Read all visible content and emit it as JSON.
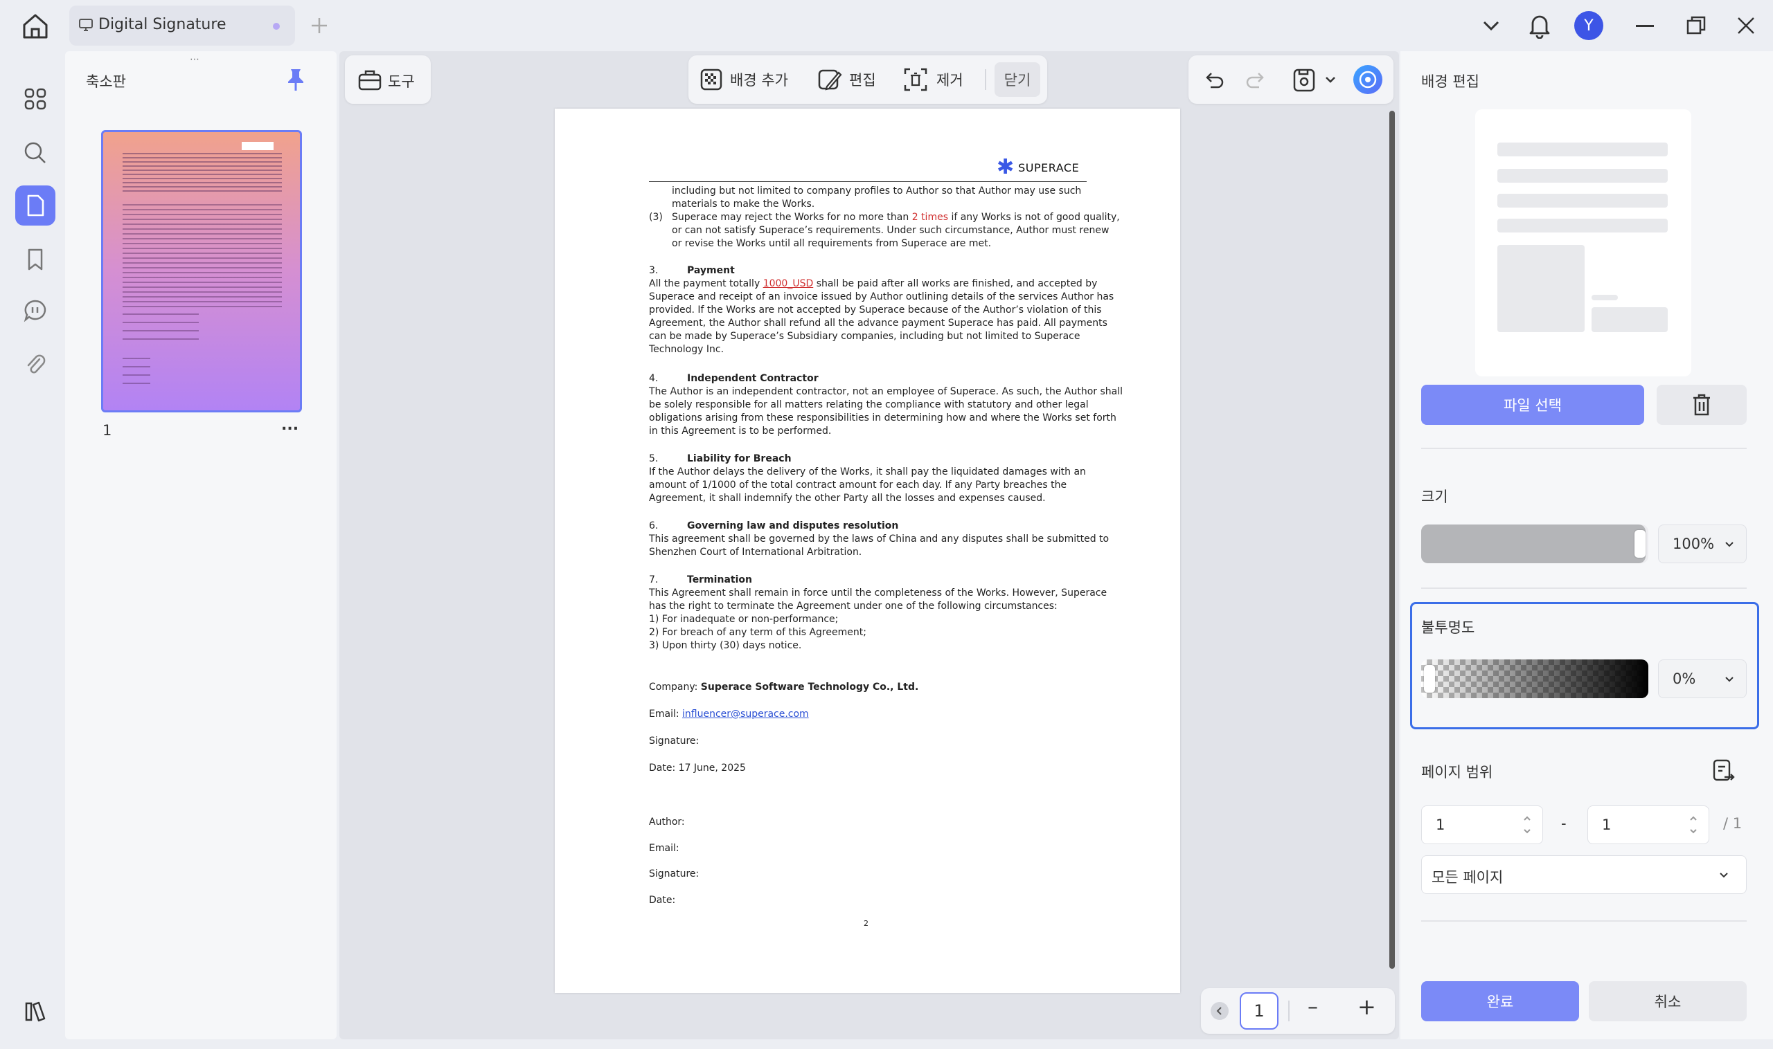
{
  "tab": {
    "title": "Digital Signature"
  },
  "user": {
    "avatar_initial": "Y"
  },
  "sidebar": {
    "panel_title": "축소판"
  },
  "thumbnail": {
    "page_number": "1",
    "more": "..."
  },
  "toolbar": {
    "tools_label": "도구",
    "bg_add_label": "배경 추가",
    "edit_label": "편집",
    "remove_label": "제거",
    "close_label": "닫기"
  },
  "document": {
    "logo_text": "SUPERACE",
    "clause2_cont_1": "including but not limited to company profiles to Author so that Author may use such",
    "clause2_cont_2": "materials to make the Works.",
    "clause3_num": "(3)",
    "clause3_a": "Superace may reject the Works for no more than",
    "clause3_red": "2 times",
    "clause3_b": "if any Works is not of good quality,",
    "clause3_2": "or can not satisfy Superace’s requirements. Under such circumstance, Author must renew",
    "clause3_3": "or revise the Works until all requirements from Superace are met.",
    "s3_num": "3.",
    "s3_title": "Payment",
    "s3_l1a": "All the payment totally",
    "s3_l1_red": "1000_USD",
    "s3_l1b": "shall be paid after all works are finished, and accepted by",
    "s3_l2": "Superace and receipt of an invoice issued by Author outlining details of the services Author has",
    "s3_l3": "provided. If the Works are not accepted by Superace because of the Author’s violation of this",
    "s3_l4": "Agreement, the Author shall refund all the advance payment Superace has paid. All payments",
    "s3_l5": "can be made by Superace’s Subsidiary companies, including but not limited to Superace",
    "s3_l6": "Technology Inc.",
    "s4_num": "4.",
    "s4_title": "Independent Contractor",
    "s4_l1": "The Author is an independent contractor, not an employee of Superace. As such, the Author shall",
    "s4_l2": "be solely responsible for all matters relating the compliance with statutory and other legal",
    "s4_l3": "obligations arising from these responsibilities in determining how and where the Works set forth",
    "s4_l4": "in this Agreement is to be performed.",
    "s5_num": "5.",
    "s5_title": "Liability for Breach",
    "s5_l1": "If the Author delays the delivery of the Works, it shall pay the liquidated damages with an",
    "s5_l2": "amount of 1/1000 of the total contract amount for each day. If any Party breaches the",
    "s5_l3": "Agreement, it shall indemnify the other Party all the losses and expenses caused.",
    "s6_num": "6.",
    "s6_title": "Governing law and disputes resolution",
    "s6_l1": "This agreement shall be governed by the laws of China and any disputes shall be submitted to",
    "s6_l2": "Shenzhen Court of International Arbitration.",
    "s7_num": "7.",
    "s7_title": "Termination",
    "s7_l1": "This Agreement shall remain in force until the completeness of the Works. However, Superace",
    "s7_l2": "has the right to terminate the Agreement under one of the following circumstances:",
    "s7_l3": "1) For inadequate or non-performance;",
    "s7_l4": "2) For breach of any term of this Agreement;",
    "s7_l5": "3)  Upon thirty (30) days notice.",
    "company_label": "Company:",
    "company_value": "Superace Software Technology Co., Ltd.",
    "email_label": "Email:",
    "email_value": "influencer@superace.com",
    "signature_label": "Signature:",
    "date_label": "Date: 17 June, 2025",
    "author_label": "Author:",
    "email2_label": "Email:",
    "signature2_label": "Signature:",
    "date2_label": "Date:",
    "page_footer": "2"
  },
  "pager": {
    "current_page": "1",
    "zoom_out": "–",
    "zoom_in": "+"
  },
  "right_panel": {
    "title": "배경 편집",
    "file_select": "파일 선택",
    "size_label": "크기",
    "size_value": "100%",
    "size_level": 1.0,
    "opacity_label": "불투명도",
    "opacity_value": "0%",
    "opacity_level": 0.0,
    "page_range_label": "페이지 범위",
    "range_from": "1",
    "range_dash": "-",
    "range_to": "1",
    "range_total": "/ 1",
    "page_select": "모든 페이지",
    "done": "완료",
    "cancel": "취소"
  },
  "colors": {
    "accent": "#7b8af7",
    "selection": "#3b6ee8",
    "done_button": "#7b8af7"
  }
}
